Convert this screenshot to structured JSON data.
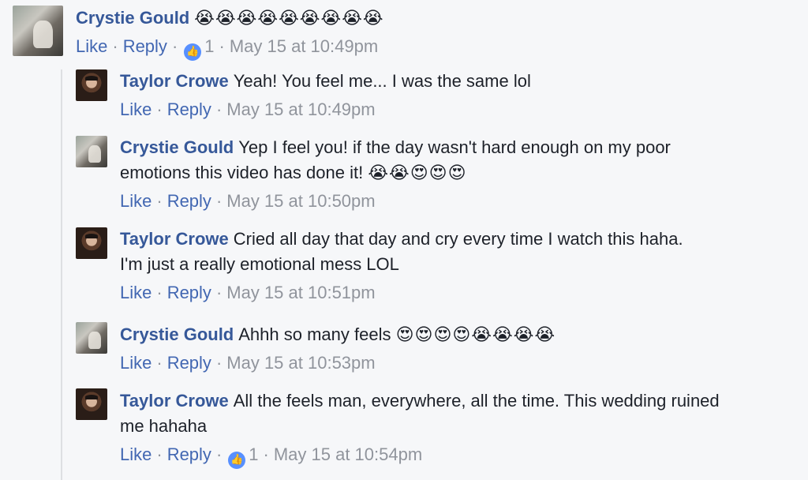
{
  "comments": [
    {
      "author": "Crystie Gould",
      "text": "",
      "emoji": "😭😭😭😭😭😭😭😭😭",
      "like_label": "Like",
      "reply_label": "Reply",
      "like_count": "1",
      "time": "May 15 at 10:49pm"
    },
    {
      "author": "Taylor Crowe",
      "text": "Yeah! You feel me... I was the same lol",
      "like_label": "Like",
      "reply_label": "Reply",
      "time": "May 15 at 10:49pm"
    },
    {
      "author": "Crystie Gould",
      "text": "Yep I feel you! if the day wasn't hard enough on my poor emotions this video has done it!",
      "emoji": "😭😭😍😍😍",
      "like_label": "Like",
      "reply_label": "Reply",
      "time": "May 15 at 10:50pm"
    },
    {
      "author": "Taylor Crowe",
      "text": "Cried all day that day and cry every time I watch this haha. I'm just a really emotional mess LOL",
      "like_label": "Like",
      "reply_label": "Reply",
      "time": "May 15 at 10:51pm"
    },
    {
      "author": "Crystie Gould",
      "text": "Ahhh so many feels",
      "emoji": "😍😍😍😍😭😭😭😭",
      "like_label": "Like",
      "reply_label": "Reply",
      "time": "May 15 at 10:53pm"
    },
    {
      "author": "Taylor Crowe",
      "text": "All the feels man, everywhere, all the time. This wedding ruined me hahaha",
      "like_label": "Like",
      "reply_label": "Reply",
      "like_count": "1",
      "time": "May 15 at 10:54pm"
    }
  ]
}
